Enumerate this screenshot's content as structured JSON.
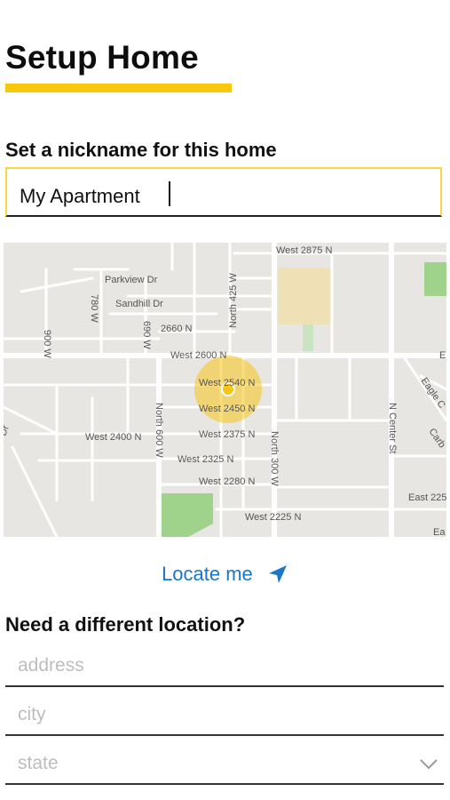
{
  "header": {
    "title": "Setup Home"
  },
  "nickname": {
    "label": "Set a nickname for this home",
    "value": "My Apartment"
  },
  "map": {
    "labels": {
      "w2875n": "West 2875 N",
      "parkview": "Parkview Dr",
      "sandhill": "Sandhill Dr",
      "w2660n": "2660 N",
      "n425w": "North 425 W",
      "w900": "900 W",
      "w780": "780 W",
      "w690": "690 W",
      "w2600n": "West 2600 N",
      "e": "E",
      "w2540n": "West 2540 N",
      "w2450n": "West 2450 N",
      "n600w": "North 600 W",
      "w2400n": "West 2400 N",
      "w2375n": "West 2375 N",
      "w2325n": "West 2325 N",
      "w2280n": "West 2280 N",
      "n300w": "North 300 W",
      "w2225n": "West 2225 N",
      "ncenter": "N Center St",
      "eagle": "Eagle C",
      "carb": "Carb",
      "east225": "East 225",
      "ea": "Ea",
      "dr": "Dr"
    },
    "colors": {
      "marker": "#f5c518",
      "park": "#9fd28a",
      "campus": "#efe0b6"
    }
  },
  "locate": {
    "label": "Locate me",
    "icon": "navigation-arrow-icon"
  },
  "different": {
    "label": "Need a different location?",
    "address_placeholder": "address",
    "city_placeholder": "city",
    "state_placeholder": "state"
  },
  "colors": {
    "accent": "#f8c80c",
    "link": "#1a76c6"
  }
}
